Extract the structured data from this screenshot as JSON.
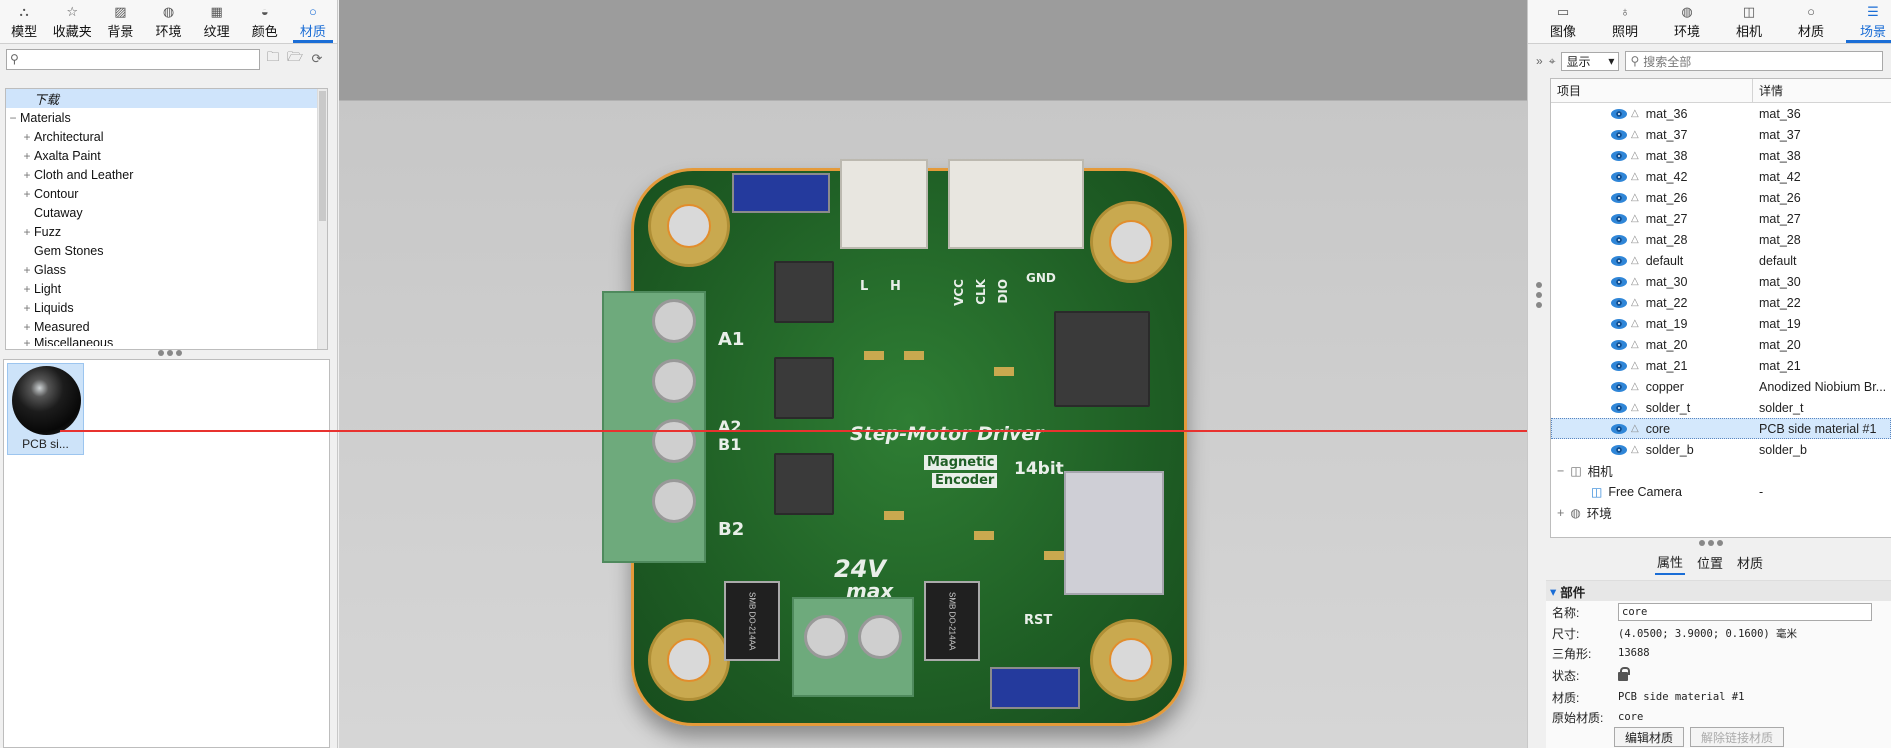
{
  "left_panel": {
    "tabs": [
      {
        "label": "模型",
        "icon": "model-icon"
      },
      {
        "label": "收藏夹",
        "icon": "star-icon"
      },
      {
        "label": "背景",
        "icon": "background-icon"
      },
      {
        "label": "环境",
        "icon": "globe-icon"
      },
      {
        "label": "纹理",
        "icon": "texture-icon"
      },
      {
        "label": "颜色",
        "icon": "color-icon"
      },
      {
        "label": "材质",
        "icon": "material-icon"
      }
    ],
    "active_tab": "材质",
    "search_placeholder": "",
    "tree": [
      {
        "label": "下载",
        "expander": "",
        "selected": true,
        "indent": 1
      },
      {
        "label": "Materials",
        "expander": "−",
        "indent": 0
      },
      {
        "label": "Architectural",
        "expander": "+",
        "indent": 1
      },
      {
        "label": "Axalta Paint",
        "expander": "+",
        "indent": 1
      },
      {
        "label": "Cloth and Leather",
        "expander": "+",
        "indent": 1
      },
      {
        "label": "Contour",
        "expander": "+",
        "indent": 1
      },
      {
        "label": "Cutaway",
        "expander": "",
        "indent": 1
      },
      {
        "label": "Fuzz",
        "expander": "+",
        "indent": 1
      },
      {
        "label": "Gem Stones",
        "expander": "",
        "indent": 1
      },
      {
        "label": "Glass",
        "expander": "+",
        "indent": 1
      },
      {
        "label": "Light",
        "expander": "+",
        "indent": 1
      },
      {
        "label": "Liquids",
        "expander": "+",
        "indent": 1
      },
      {
        "label": "Measured",
        "expander": "+",
        "indent": 1
      },
      {
        "label": "Miscellaneous",
        "expander": "+",
        "indent": 1
      }
    ],
    "material_thumb": {
      "label": "PCB si..."
    }
  },
  "viewport": {
    "board_labels": {
      "title": "Step-Motor Driver",
      "magnetic": "Magnetic",
      "encoder": "Encoder",
      "bits": "14bit",
      "voltage": "24V",
      "max": "max",
      "rst": "RST",
      "a1": "A1",
      "a2": "A2",
      "b1": "B1",
      "b2": "B2",
      "l": "L",
      "h": "H",
      "vcc": "VCC",
      "clk": "CLK",
      "dio": "DIO",
      "gnd": "GND",
      "diode1": "SMB DO-214AA",
      "diode2": "SMB DO-214AA"
    }
  },
  "right_panel": {
    "tabs": [
      {
        "label": "图像",
        "icon": "image-icon"
      },
      {
        "label": "照明",
        "icon": "bulb-icon"
      },
      {
        "label": "环境",
        "icon": "globe-icon"
      },
      {
        "label": "相机",
        "icon": "camera-icon"
      },
      {
        "label": "材质",
        "icon": "material-icon"
      },
      {
        "label": "场景",
        "icon": "scene-icon"
      }
    ],
    "active_tab": "场景",
    "display_select": "显示",
    "search_placeholder": "搜索全部",
    "columns": [
      "项目",
      "详情"
    ],
    "rows": [
      {
        "name": "mat_36",
        "detail": "mat_36"
      },
      {
        "name": "mat_37",
        "detail": "mat_37"
      },
      {
        "name": "mat_38",
        "detail": "mat_38"
      },
      {
        "name": "mat_42",
        "detail": "mat_42"
      },
      {
        "name": "mat_26",
        "detail": "mat_26"
      },
      {
        "name": "mat_27",
        "detail": "mat_27"
      },
      {
        "name": "mat_28",
        "detail": "mat_28"
      },
      {
        "name": "default",
        "detail": "default"
      },
      {
        "name": "mat_30",
        "detail": "mat_30"
      },
      {
        "name": "mat_22",
        "detail": "mat_22"
      },
      {
        "name": "mat_19",
        "detail": "mat_19"
      },
      {
        "name": "mat_20",
        "detail": "mat_20"
      },
      {
        "name": "mat_21",
        "detail": "mat_21"
      },
      {
        "name": "copper",
        "detail": "Anodized Niobium Br..."
      },
      {
        "name": "solder_t",
        "detail": "solder_t"
      },
      {
        "name": "core",
        "detail": "PCB side material #1",
        "selected": true
      },
      {
        "name": "solder_b",
        "detail": "solder_b"
      }
    ],
    "camera_group": "相机",
    "camera_item": {
      "name": "Free Camera",
      "detail": "-"
    },
    "env_group": "环境",
    "subtabs": [
      "属性",
      "位置",
      "材质"
    ],
    "active_subtab": "属性",
    "section_title": "部件",
    "props": {
      "name_label": "名称:",
      "name_value": "core",
      "size_label": "尺寸:",
      "size_value": "(4.0500; 3.9000; 0.1600) 毫米",
      "tri_label": "三角形:",
      "tri_value": "13688",
      "state_label": "状态:",
      "material_label": "材质:",
      "material_value": "PCB side material #1",
      "orig_label": "原始材质:",
      "orig_value": "core"
    },
    "buttons": {
      "edit": "编辑材质",
      "unlink": "解除链接材质"
    }
  }
}
